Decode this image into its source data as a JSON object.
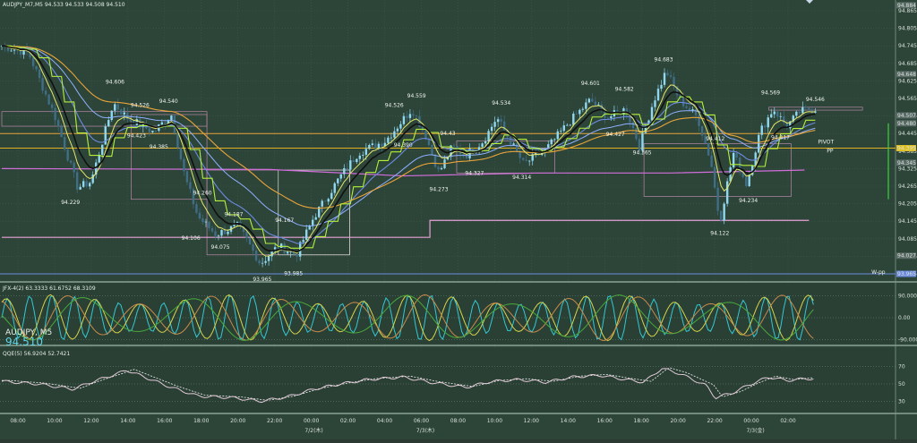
{
  "colors": {
    "panel_bg": "#2d4438",
    "grid": "#3d5a4c",
    "bull": "#8fd8ef",
    "bear": "#3f6e86",
    "price_line": "#3a4a45",
    "ma_black": "#111111",
    "ma_lime": "#b4f03c",
    "ma_yellow": "#e6e86a",
    "ma_blue": "#6c8be0",
    "ma_blue_light": "#8fb0ff",
    "ma_orange": "#e8a43a",
    "pivot_pink": "#e7a2d7",
    "magenta": "#d26edc",
    "osc_cyan": "#33c8d4",
    "osc_yellow": "#d7d34a",
    "osc_orange": "#c88a4a",
    "osc_green": "#49a83a",
    "qqe_line": "#e0c9d6",
    "qqe_dash": "#f0f0f0"
  },
  "header": {
    "main_info": "AUDJPY_M7,M5  94.533 94.533 94.508 94.510",
    "osc_info": "JFX-4(2) 63.3333 61.6752 68.3109",
    "symbol": "AUDJPY, M5",
    "price_big": "94.510",
    "qqe_info": "QQE(5) 56.9204 52.7421"
  },
  "chart_data": [
    {
      "type": "line",
      "title": "AUDJPY_M7,M5",
      "ylim": [
        93.965,
        94.865
      ],
      "y_ticks": [
        "94.865",
        "94.805",
        "94.745",
        "94.685",
        "94.625",
        "94.565",
        "94.505",
        "94.445",
        "94.385",
        "94.325",
        "94.265",
        "94.205",
        "94.145",
        "94.085",
        "94.025",
        "93.965"
      ],
      "x_ticks": [
        "08:00",
        "10:00",
        "12:00",
        "14:00",
        "16:00",
        "18:00",
        "20:00",
        "22:00",
        "00:00",
        "02:00",
        "04:00",
        "06:00",
        "08:00",
        "10:00",
        "12:00",
        "14:00",
        "16:00",
        "18:00",
        "20:00",
        "22:00",
        "00:00",
        "02:00"
      ],
      "date_labels": [
        "7/2(木)",
        "7/3(木)",
        "7/3(金)"
      ],
      "axis_markers": [
        "94.884",
        "94.648",
        "94.507",
        "94.480",
        "94.395",
        "94.345",
        "94.027",
        "93.965"
      ],
      "price_labels": [
        {
          "t": 0.127,
          "v": 94.606,
          "text": "94.606"
        },
        {
          "t": 0.155,
          "v": 94.526,
          "text": "94.526"
        },
        {
          "t": 0.187,
          "v": 94.54,
          "text": "94.540"
        },
        {
          "t": 0.151,
          "v": 94.423,
          "text": "94.423"
        },
        {
          "t": 0.176,
          "v": 94.385,
          "text": "94.385"
        },
        {
          "t": 0.077,
          "v": 94.229,
          "text": "94.229"
        },
        {
          "t": 0.225,
          "v": 94.26,
          "text": "94.260"
        },
        {
          "t": 0.26,
          "v": 94.187,
          "text": "94.187"
        },
        {
          "t": 0.212,
          "v": 94.106,
          "text": "94.106"
        },
        {
          "t": 0.245,
          "v": 94.075,
          "text": "94.075"
        },
        {
          "t": 0.317,
          "v": 94.167,
          "text": "94.167"
        },
        {
          "t": 0.327,
          "v": 93.985,
          "text": "93.985"
        },
        {
          "t": 0.292,
          "v": 93.965,
          "text": "93.965"
        },
        {
          "t": 0.44,
          "v": 94.526,
          "text": "94.526"
        },
        {
          "t": 0.465,
          "v": 94.559,
          "text": "94.559"
        },
        {
          "t": 0.45,
          "v": 94.39,
          "text": "94.390"
        },
        {
          "t": 0.5,
          "v": 94.43,
          "text": "94.43"
        },
        {
          "t": 0.49,
          "v": 94.273,
          "text": "94.273"
        },
        {
          "t": 0.53,
          "v": 94.327,
          "text": "94.327"
        },
        {
          "t": 0.56,
          "v": 94.534,
          "text": "94.534"
        },
        {
          "t": 0.583,
          "v": 94.314,
          "text": "94.314"
        },
        {
          "t": 0.66,
          "v": 94.601,
          "text": "94.601"
        },
        {
          "t": 0.698,
          "v": 94.582,
          "text": "94.582"
        },
        {
          "t": 0.688,
          "v": 94.427,
          "text": "94.427"
        },
        {
          "t": 0.718,
          "v": 94.365,
          "text": "94.365"
        },
        {
          "t": 0.742,
          "v": 94.683,
          "text": "94.683"
        },
        {
          "t": 0.8,
          "v": 94.412,
          "text": "94.412"
        },
        {
          "t": 0.862,
          "v": 94.569,
          "text": "94.569"
        },
        {
          "t": 0.912,
          "v": 94.546,
          "text": "94.546"
        },
        {
          "t": 0.873,
          "v": 94.417,
          "text": "94.417"
        },
        {
          "t": 0.837,
          "v": 94.234,
          "text": "94.234"
        },
        {
          "t": 0.805,
          "v": 94.122,
          "text": "94.122"
        }
      ],
      "annotations": [
        {
          "text": "PIVOT",
          "t": 0.915,
          "v": 94.41
        },
        {
          "text": "PP",
          "t": 0.925,
          "v": 94.38
        },
        {
          "text": "W-pp",
          "t": 0.975,
          "v": 93.965
        }
      ],
      "pivot_levels": [
        94.4,
        94.425,
        94.46
      ],
      "weekly_line": [
        [
          0.0,
          94.09
        ],
        [
          0.48,
          94.09
        ],
        [
          0.48,
          94.148
        ],
        [
          0.905,
          94.148
        ]
      ],
      "magenta_line": [
        [
          0.0,
          94.325
        ],
        [
          0.3,
          94.322
        ],
        [
          0.45,
          94.3
        ],
        [
          0.6,
          94.31
        ],
        [
          0.75,
          94.31
        ],
        [
          0.9,
          94.32
        ]
      ],
      "key_points": [
        [
          0.0,
          94.745
        ],
        [
          0.03,
          94.72
        ],
        [
          0.06,
          94.5
        ],
        [
          0.085,
          94.26
        ],
        [
          0.1,
          94.28
        ],
        [
          0.125,
          94.55
        ],
        [
          0.14,
          94.5
        ],
        [
          0.17,
          94.45
        ],
        [
          0.19,
          94.51
        ],
        [
          0.205,
          94.3
        ],
        [
          0.22,
          94.16
        ],
        [
          0.24,
          94.1
        ],
        [
          0.265,
          94.13
        ],
        [
          0.29,
          94.0
        ],
        [
          0.31,
          94.06
        ],
        [
          0.33,
          94.03
        ],
        [
          0.35,
          94.16
        ],
        [
          0.38,
          94.3
        ],
        [
          0.4,
          94.38
        ],
        [
          0.43,
          94.42
        ],
        [
          0.46,
          94.53
        ],
        [
          0.475,
          94.44
        ],
        [
          0.49,
          94.31
        ],
        [
          0.505,
          94.4
        ],
        [
          0.52,
          94.37
        ],
        [
          0.54,
          94.42
        ],
        [
          0.555,
          94.5
        ],
        [
          0.57,
          94.42
        ],
        [
          0.585,
          94.34
        ],
        [
          0.61,
          94.39
        ],
        [
          0.635,
          94.48
        ],
        [
          0.66,
          94.56
        ],
        [
          0.68,
          94.5
        ],
        [
          0.7,
          94.53
        ],
        [
          0.715,
          94.4
        ],
        [
          0.73,
          94.55
        ],
        [
          0.745,
          94.66
        ],
        [
          0.76,
          94.56
        ],
        [
          0.78,
          94.5
        ],
        [
          0.795,
          94.35
        ],
        [
          0.805,
          94.14
        ],
        [
          0.82,
          94.38
        ],
        [
          0.835,
          94.27
        ],
        [
          0.85,
          94.45
        ],
        [
          0.865,
          94.53
        ],
        [
          0.88,
          94.47
        ],
        [
          0.895,
          94.52
        ],
        [
          0.91,
          94.53
        ]
      ]
    },
    {
      "type": "line",
      "title": "JFX-4(2)",
      "ylim": [
        -100,
        100
      ],
      "y_ticks": [
        "90.0000",
        "0.00",
        "-90.0000"
      ],
      "series": [
        {
          "color": "osc_cyan",
          "period": 0.025
        },
        {
          "color": "osc_yellow",
          "period": 0.05
        },
        {
          "color": "osc_orange",
          "period": 0.08
        },
        {
          "color": "osc_green",
          "period": 0.12
        }
      ]
    },
    {
      "type": "line",
      "title": "QQE(5)",
      "ylim": [
        20,
        80
      ],
      "y_ticks": [
        "70",
        "50",
        "30"
      ],
      "key_points": [
        [
          0.0,
          53
        ],
        [
          0.04,
          50
        ],
        [
          0.08,
          44
        ],
        [
          0.1,
          52
        ],
        [
          0.13,
          62
        ],
        [
          0.14,
          66
        ],
        [
          0.16,
          58
        ],
        [
          0.19,
          46
        ],
        [
          0.22,
          36
        ],
        [
          0.26,
          34
        ],
        [
          0.29,
          30
        ],
        [
          0.32,
          35
        ],
        [
          0.35,
          44
        ],
        [
          0.38,
          50
        ],
        [
          0.41,
          55
        ],
        [
          0.45,
          58
        ],
        [
          0.48,
          52
        ],
        [
          0.52,
          46
        ],
        [
          0.55,
          53
        ],
        [
          0.58,
          55
        ],
        [
          0.61,
          52
        ],
        [
          0.64,
          58
        ],
        [
          0.67,
          60
        ],
        [
          0.7,
          55
        ],
        [
          0.72,
          52
        ],
        [
          0.74,
          68
        ],
        [
          0.76,
          62
        ],
        [
          0.79,
          48
        ],
        [
          0.8,
          34
        ],
        [
          0.82,
          40
        ],
        [
          0.84,
          50
        ],
        [
          0.86,
          58
        ],
        [
          0.88,
          54
        ],
        [
          0.9,
          56
        ],
        [
          0.91,
          56
        ]
      ]
    }
  ]
}
